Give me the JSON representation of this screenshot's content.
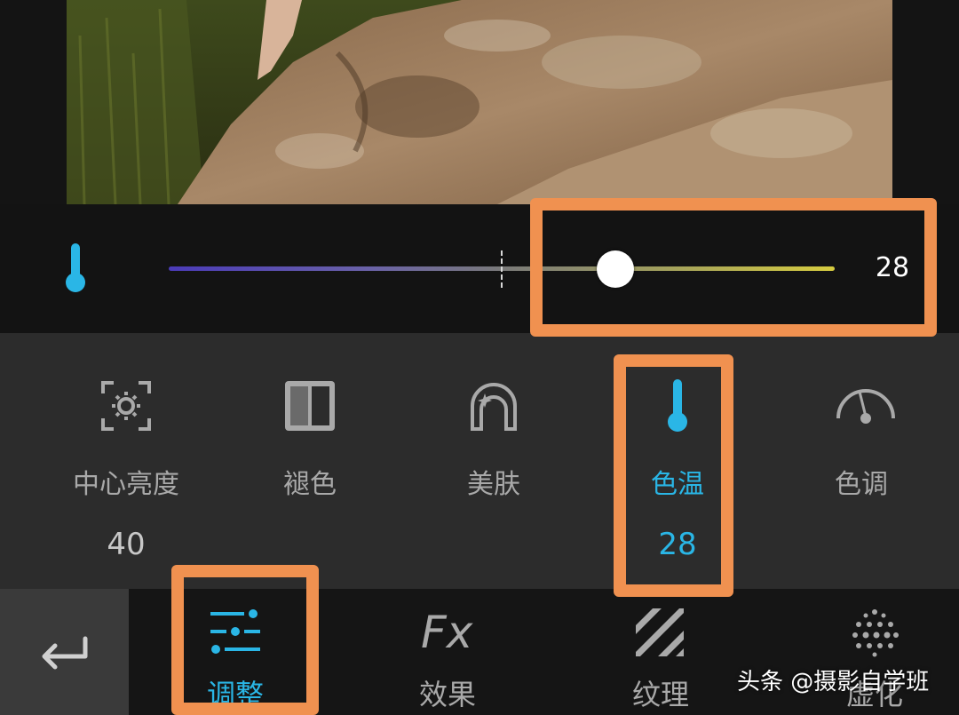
{
  "slider": {
    "label_icon": "thermometer-icon",
    "value_text": "28",
    "level_fraction": 0.67,
    "gradient_colors": [
      "#4b3bb8",
      "#7a7a7a",
      "#d6cc40"
    ]
  },
  "tools": [
    {
      "icon": "center-brightness-icon",
      "label": "中心亮度",
      "value": "40",
      "active": false
    },
    {
      "icon": "fade-icon",
      "label": "褪色",
      "value": "",
      "active": false
    },
    {
      "icon": "skin-beauty-icon",
      "label": "美肤",
      "value": "",
      "active": false
    },
    {
      "icon": "thermometer-icon",
      "label": "色温",
      "value": "28",
      "active": true
    },
    {
      "icon": "tone-gauge-icon",
      "label": "色调",
      "value": "",
      "active": false
    }
  ],
  "tabs": [
    {
      "icon": "adjust-sliders-icon",
      "label": "调整",
      "active": true
    },
    {
      "icon": "fx-icon",
      "label": "效果",
      "active": false
    },
    {
      "icon": "texture-stripes-icon",
      "label": "纹理",
      "active": false
    },
    {
      "icon": "blur-dots-icon",
      "label": "虚化",
      "active": false
    }
  ],
  "back_icon": "return-arrow-icon",
  "watermark": "头条 @摄影自学班",
  "colors": {
    "accent": "#2ab6e6",
    "highlight": "#f09150",
    "panel": "#2c2c2c",
    "inactive_text": "#a9a9a9"
  }
}
